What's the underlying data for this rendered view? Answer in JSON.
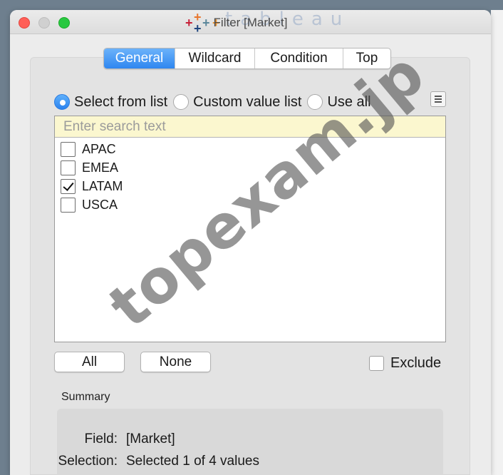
{
  "window": {
    "title": "Filter [Market]"
  },
  "tabs": [
    "General",
    "Wildcard",
    "Condition",
    "Top"
  ],
  "active_tab": "General",
  "radio_options": [
    "Select from list",
    "Custom value list",
    "Use all"
  ],
  "selected_radio": "Select from list",
  "search": {
    "placeholder": "Enter search text",
    "value": ""
  },
  "items": [
    {
      "label": "APAC",
      "checked": false
    },
    {
      "label": "EMEA",
      "checked": false
    },
    {
      "label": "LATAM",
      "checked": true
    },
    {
      "label": "USCA",
      "checked": false
    }
  ],
  "buttons": {
    "all": "All",
    "none": "None"
  },
  "exclude": {
    "label": "Exclude",
    "checked": false
  },
  "summary": {
    "title": "Summary",
    "field_label": "Field:",
    "field_value": "[Market]",
    "selection_label": "Selection:",
    "selection_value": "Selected 1 of 4 values"
  },
  "watermark": "topexam.jp",
  "logo_text": "tableau",
  "colors": {
    "accent": "#2e86f0",
    "search_bg": "#fbf7cf",
    "close": "#ff5f57",
    "maximize": "#28c840"
  }
}
